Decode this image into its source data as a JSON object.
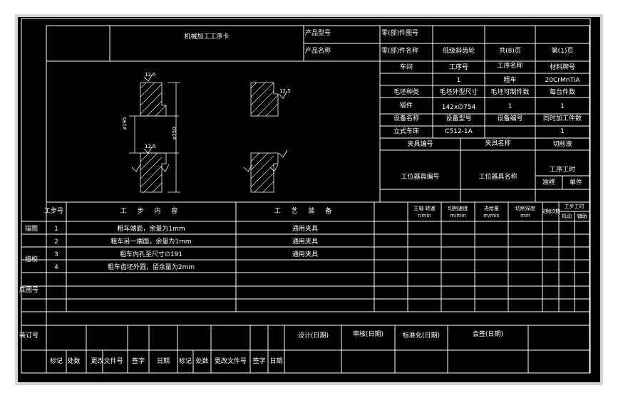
{
  "card": {
    "title": "机械加工工序卡",
    "product_model_label": "产品型号",
    "product_name_label": "产品名称",
    "part_no_label": "零(部)件图号",
    "part_name_label": "零(部)件名称",
    "part_name_value": "低级斜齿轮",
    "total_pages": "共(8)页",
    "page_no": "第(1)页"
  },
  "info": {
    "workshop_label": "车间",
    "process_no_label": "工序号",
    "process_name_label": "工序名称",
    "material_label": "材料牌号",
    "process_no": "1",
    "process_name": "粗车",
    "material": "20CrMnTiA",
    "blank_type_label": "毛坯种类",
    "blank_size_label": "毛坯外型尺寸",
    "blank_count_label": "毛坯可制件数",
    "per_unit_label": "每台件数",
    "blank_type": "锻件",
    "blank_size": "142x∅754",
    "blank_count": "1",
    "per_unit": "1",
    "equip_name_label": "设备名称",
    "equip_model_label": "设备型号",
    "equip_no_label": "设备编号",
    "simul_label": "同时加工件数",
    "equip_name": "立式车床",
    "equip_model": "C512-1A",
    "simul": "1",
    "fixture_no_label": "夹具编号",
    "fixture_name_label": "夹具名称",
    "coolant_label": "切削液",
    "station_no_label": "工位器具编号",
    "station_name_label": "工位器具名称",
    "time_label": "工序工时",
    "time_prep": "准终",
    "time_unit": "单件"
  },
  "drawing": {
    "left_dims": [
      "12.5",
      "ø195",
      "12.5",
      "ø750"
    ],
    "right_dims": [
      "12.5"
    ]
  },
  "steps_header": {
    "no": "工步号",
    "content": "工 步 内 容",
    "equipment": "工 艺 装 备",
    "spindle": "主轴 转速",
    "spindle_unit": "r/min",
    "speed": "切削速度",
    "speed_unit": "m/min",
    "feed": "进给量",
    "feed_unit": "m/min",
    "depth": "切削深度",
    "depth_unit": "mm",
    "passes": "进给次数",
    "time": "工步工时",
    "time_machine": "机动",
    "time_aux": "辅助"
  },
  "steps": [
    {
      "no": "1",
      "content": "粗车端面，余量为1mm",
      "equipment": "通用夹具"
    },
    {
      "no": "2",
      "content": "粗车另一端面，余量为1mm",
      "equipment": "通用夹具"
    },
    {
      "no": "3",
      "content": "粗车内孔至尺寸∅191",
      "equipment": "通用夹具"
    },
    {
      "no": "4",
      "content": "粗车齿坯外圆，留余量为2mm",
      "equipment": ""
    }
  ],
  "side_labels": {
    "tracing": "描图",
    "checking": "描校",
    "base_drawing": "底图号",
    "binding": "装订号"
  },
  "footer": {
    "design": "设计(日期)",
    "review": "审核(日期)",
    "standard": "标准化(日期)",
    "sign": "会签(日期)",
    "mark": "标记",
    "count": "处数",
    "doc": "更改文件号",
    "signature": "签字",
    "date": "日期"
  }
}
